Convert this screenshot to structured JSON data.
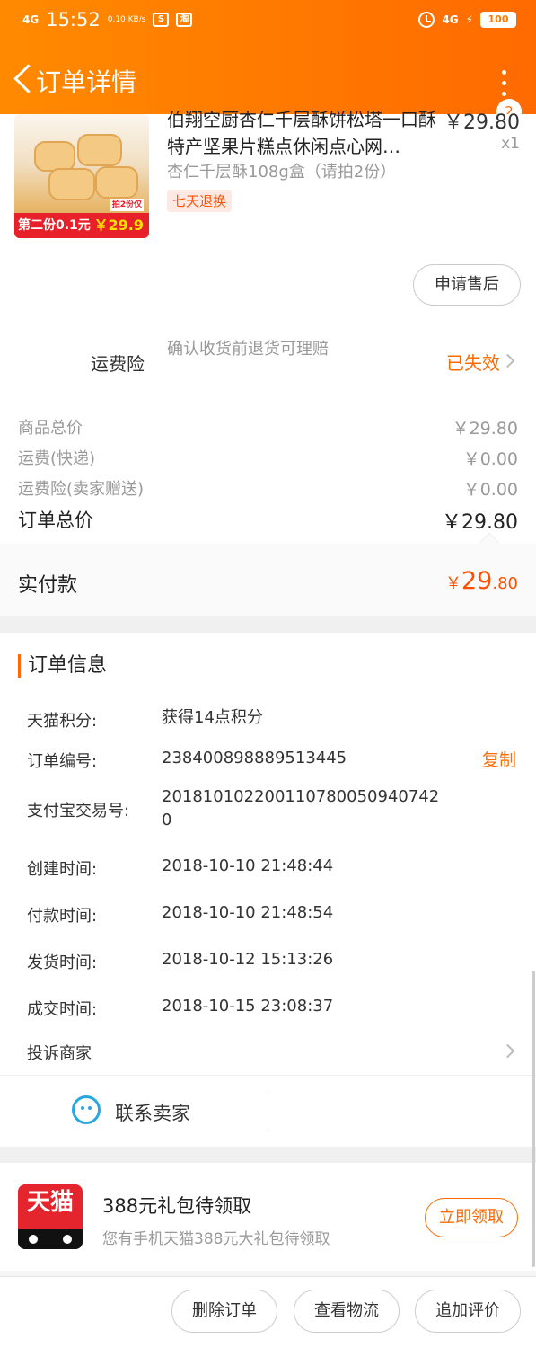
{
  "status_bar": {
    "signal": "4G",
    "time": "15:52",
    "speed": "0.10 KB/s",
    "icons": [
      "notification-icon",
      "taobao-icon"
    ],
    "network": "4G",
    "battery": "100"
  },
  "nav": {
    "title": "订单详情",
    "badge_count": "2"
  },
  "product": {
    "title": "伯翔空厨杏仁千层酥饼松塔一口酥特产坚果片糕点休闲点心网…",
    "price": "￥29.80",
    "qty": "x1",
    "spec": "杏仁千层酥108g盒（请拍2份）",
    "tag": "七天退换",
    "image_promo": "第二份0.1元",
    "image_promo_price": "￥29.9",
    "image_promo_note": "拍2份仅"
  },
  "after_sale_button": "申请售后",
  "insurance": {
    "label": "运费险",
    "desc": "确认收货前退货可理赔",
    "status": "已失效"
  },
  "fees": [
    {
      "label": "商品总价",
      "value": "￥29.80"
    },
    {
      "label": "运费(快递)",
      "value": "￥0.00"
    },
    {
      "label": "运费险(卖家赠送)",
      "value": "￥0.00"
    }
  ],
  "order_total": {
    "label": "订单总价",
    "value": "￥29.80"
  },
  "paid": {
    "label": "实付款",
    "currency": "￥",
    "int": "29",
    "dec": ".80"
  },
  "order_info": {
    "title": "订单信息",
    "rows": [
      {
        "label": "天猫积分:",
        "value": "获得14点积分"
      },
      {
        "label": "订单编号:",
        "value": "238400898889513445"
      },
      {
        "label": "支付宝交易号:",
        "value": "2018101022001107800509407420"
      },
      {
        "label": "创建时间:",
        "value": "2018-10-10 21:48:44"
      },
      {
        "label": "付款时间:",
        "value": "2018-10-10 21:48:54"
      },
      {
        "label": "发货时间:",
        "value": "2018-10-12 15:13:26"
      },
      {
        "label": "成交时间:",
        "value": "2018-10-15 23:08:37"
      }
    ],
    "copy_label": "复制",
    "complain_label": "投诉商家"
  },
  "contact": {
    "label": "联系卖家"
  },
  "promo_card": {
    "logo_text": "天猫",
    "title": "388元礼包待领取",
    "subtitle": "您有手机天猫388元大礼包待领取",
    "button": "立即领取"
  },
  "bottom_actions": [
    "删除订单",
    "查看物流",
    "追加评价"
  ],
  "colors": {
    "accent": "#ff6a00",
    "header_start": "#ff8a00",
    "price_red": "#ff5000",
    "tmall_red": "#e4252d"
  }
}
